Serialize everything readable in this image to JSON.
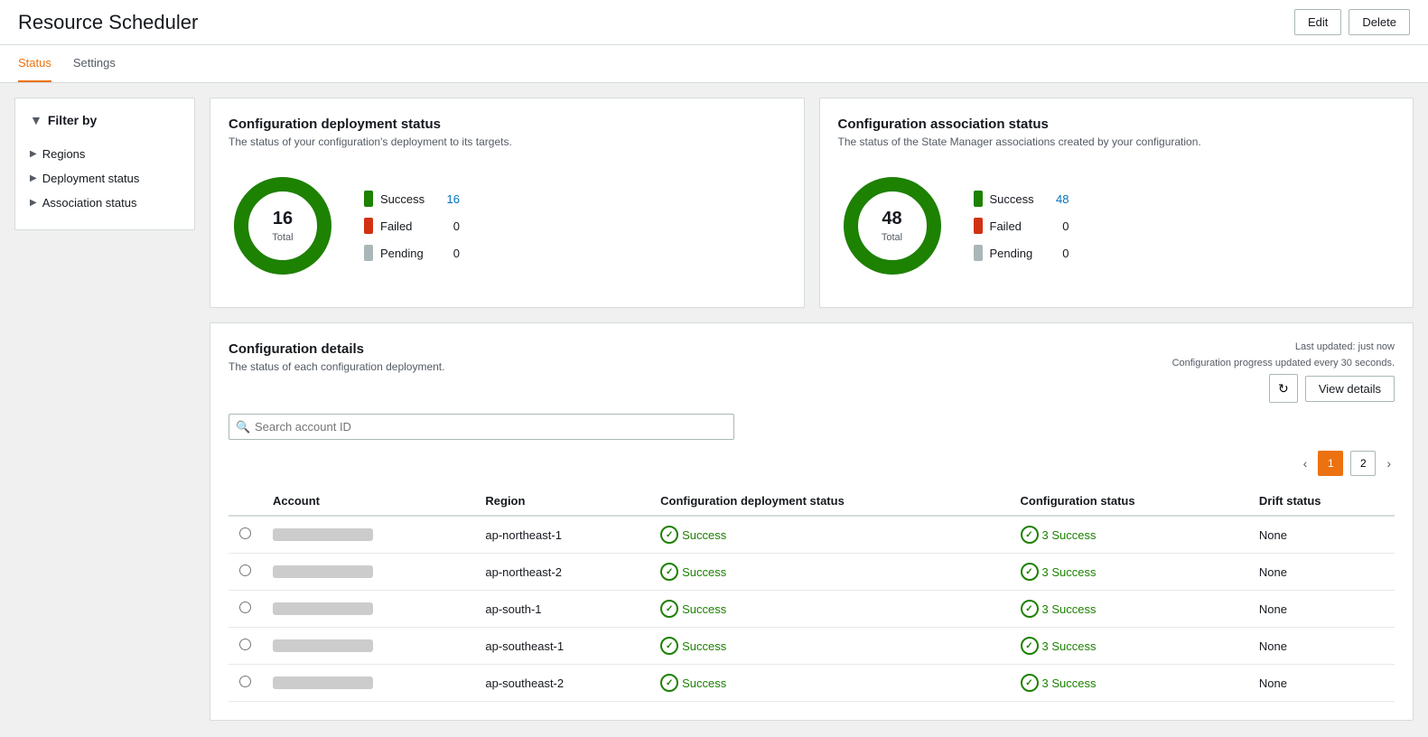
{
  "header": {
    "title": "Resource Scheduler",
    "edit_label": "Edit",
    "delete_label": "Delete"
  },
  "tabs": [
    {
      "id": "status",
      "label": "Status",
      "active": true
    },
    {
      "id": "settings",
      "label": "Settings",
      "active": false
    }
  ],
  "sidebar": {
    "title": "Filter by",
    "items": [
      {
        "id": "regions",
        "label": "Regions"
      },
      {
        "id": "deployment-status",
        "label": "Deployment status"
      },
      {
        "id": "association-status",
        "label": "Association status"
      }
    ]
  },
  "deployment_status": {
    "title": "Configuration deployment status",
    "subtitle": "The status of your configuration's deployment to its targets.",
    "total": 16,
    "total_label": "Total",
    "legend": [
      {
        "id": "success",
        "label": "Success",
        "count": 16,
        "color": "success"
      },
      {
        "id": "failed",
        "label": "Failed",
        "count": 0,
        "color": "failed"
      },
      {
        "id": "pending",
        "label": "Pending",
        "count": 0,
        "color": "pending"
      }
    ]
  },
  "association_status": {
    "title": "Configuration association status",
    "subtitle": "The status of the State Manager associations created by your configuration.",
    "total": 48,
    "total_label": "Total",
    "legend": [
      {
        "id": "success",
        "label": "Success",
        "count": 48,
        "color": "success"
      },
      {
        "id": "failed",
        "label": "Failed",
        "count": 0,
        "color": "failed"
      },
      {
        "id": "pending",
        "label": "Pending",
        "count": 0,
        "color": "pending"
      }
    ]
  },
  "details": {
    "title": "Configuration details",
    "subtitle": "The status of each configuration deployment.",
    "last_updated": "Last updated: just now",
    "progress_note": "Configuration progress updated every 30 seconds.",
    "view_details_label": "View details",
    "search_placeholder": "Search account ID",
    "pagination": {
      "current_page": 1,
      "page2": 2
    },
    "table": {
      "columns": [
        "",
        "Account",
        "Region",
        "Configuration deployment status",
        "Configuration status",
        "Drift status"
      ],
      "rows": [
        {
          "account": "blurred",
          "region": "ap-northeast-1",
          "deploy_status": "Success",
          "config_status": "3 Success",
          "drift_status": "None"
        },
        {
          "account": "blurred",
          "region": "ap-northeast-2",
          "deploy_status": "Success",
          "config_status": "3 Success",
          "drift_status": "None"
        },
        {
          "account": "blurred",
          "region": "ap-south-1",
          "deploy_status": "Success",
          "config_status": "3 Success",
          "drift_status": "None"
        },
        {
          "account": "blurred",
          "region": "ap-southeast-1",
          "deploy_status": "Success",
          "config_status": "3 Success",
          "drift_status": "None"
        },
        {
          "account": "blurred",
          "region": "ap-southeast-2",
          "deploy_status": "Success",
          "config_status": "3 Success",
          "drift_status": "None"
        }
      ]
    }
  }
}
